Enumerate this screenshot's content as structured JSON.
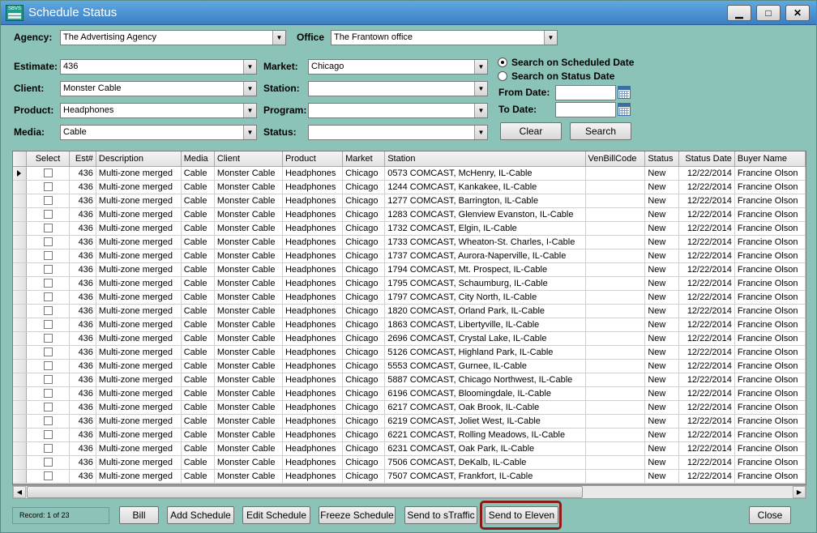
{
  "window": {
    "title": "Schedule Status",
    "icon_text": "SBVS",
    "minimize_glyph": "▁",
    "maximize_glyph": "□",
    "close_glyph": "✕"
  },
  "filters": {
    "agency_label": "Agency:",
    "agency_value": "The Advertising Agency",
    "office_label": "Office",
    "office_value": "The Frantown office",
    "estimate_label": "Estimate:",
    "estimate_value": "436",
    "client_label": "Client:",
    "client_value": "Monster Cable",
    "product_label": "Product:",
    "product_value": "Headphones",
    "media_label": "Media:",
    "media_value": "Cable",
    "market_label": "Market:",
    "market_value": "Chicago",
    "station_label": "Station:",
    "station_value": "",
    "program_label": "Program:",
    "program_value": "",
    "status_label": "Status:",
    "status_value": "",
    "radio_scheduled": "Search on Scheduled Date",
    "radio_status": "Search on Status Date",
    "selected_radio": "scheduled",
    "from_label": "From Date:",
    "to_label": "To Date:",
    "from_value": "",
    "to_value": "",
    "clear_label": "Clear",
    "search_label": "Search"
  },
  "table": {
    "columns": [
      "Select",
      "Est#",
      "Description",
      "Media",
      "Client",
      "Product",
      "Market",
      "Station",
      "VenBillCode",
      "Status",
      "Status Date",
      "Buyer Name"
    ],
    "rows": [
      [
        "",
        "436",
        "Multi-zone merged",
        "Cable",
        "Monster Cable",
        "Headphones",
        "Chicago",
        "0573 COMCAST, McHenry, IL-Cable",
        "",
        "New",
        "12/22/2014",
        "Francine Olson"
      ],
      [
        "",
        "436",
        "Multi-zone merged",
        "Cable",
        "Monster Cable",
        "Headphones",
        "Chicago",
        "1244 COMCAST, Kankakee, IL-Cable",
        "",
        "New",
        "12/22/2014",
        "Francine Olson"
      ],
      [
        "",
        "436",
        "Multi-zone merged",
        "Cable",
        "Monster Cable",
        "Headphones",
        "Chicago",
        "1277 COMCAST, Barrington, IL-Cable",
        "",
        "New",
        "12/22/2014",
        "Francine Olson"
      ],
      [
        "",
        "436",
        "Multi-zone merged",
        "Cable",
        "Monster Cable",
        "Headphones",
        "Chicago",
        "1283 COMCAST, Glenview Evanston, IL-Cable",
        "",
        "New",
        "12/22/2014",
        "Francine Olson"
      ],
      [
        "",
        "436",
        "Multi-zone merged",
        "Cable",
        "Monster Cable",
        "Headphones",
        "Chicago",
        "1732 COMCAST, Elgin, IL-Cable",
        "",
        "New",
        "12/22/2014",
        "Francine Olson"
      ],
      [
        "",
        "436",
        "Multi-zone merged",
        "Cable",
        "Monster Cable",
        "Headphones",
        "Chicago",
        "1733 COMCAST, Wheaton-St. Charles, I-Cable",
        "",
        "New",
        "12/22/2014",
        "Francine Olson"
      ],
      [
        "",
        "436",
        "Multi-zone merged",
        "Cable",
        "Monster Cable",
        "Headphones",
        "Chicago",
        "1737 COMCAST, Aurora-Naperville, IL-Cable",
        "",
        "New",
        "12/22/2014",
        "Francine Olson"
      ],
      [
        "",
        "436",
        "Multi-zone merged",
        "Cable",
        "Monster Cable",
        "Headphones",
        "Chicago",
        "1794 COMCAST, Mt. Prospect, IL-Cable",
        "",
        "New",
        "12/22/2014",
        "Francine Olson"
      ],
      [
        "",
        "436",
        "Multi-zone merged",
        "Cable",
        "Monster Cable",
        "Headphones",
        "Chicago",
        "1795 COMCAST, Schaumburg, IL-Cable",
        "",
        "New",
        "12/22/2014",
        "Francine Olson"
      ],
      [
        "",
        "436",
        "Multi-zone merged",
        "Cable",
        "Monster Cable",
        "Headphones",
        "Chicago",
        "1797 COMCAST, City North, IL-Cable",
        "",
        "New",
        "12/22/2014",
        "Francine Olson"
      ],
      [
        "",
        "436",
        "Multi-zone merged",
        "Cable",
        "Monster Cable",
        "Headphones",
        "Chicago",
        "1820 COMCAST, Orland Park, IL-Cable",
        "",
        "New",
        "12/22/2014",
        "Francine Olson"
      ],
      [
        "",
        "436",
        "Multi-zone merged",
        "Cable",
        "Monster Cable",
        "Headphones",
        "Chicago",
        "1863 COMCAST, Libertyville, IL-Cable",
        "",
        "New",
        "12/22/2014",
        "Francine Olson"
      ],
      [
        "",
        "436",
        "Multi-zone merged",
        "Cable",
        "Monster Cable",
        "Headphones",
        "Chicago",
        "2696 COMCAST, Crystal Lake, IL-Cable",
        "",
        "New",
        "12/22/2014",
        "Francine Olson"
      ],
      [
        "",
        "436",
        "Multi-zone merged",
        "Cable",
        "Monster Cable",
        "Headphones",
        "Chicago",
        "5126 COMCAST, Highland Park, IL-Cable",
        "",
        "New",
        "12/22/2014",
        "Francine Olson"
      ],
      [
        "",
        "436",
        "Multi-zone merged",
        "Cable",
        "Monster Cable",
        "Headphones",
        "Chicago",
        "5553 COMCAST, Gurnee, IL-Cable",
        "",
        "New",
        "12/22/2014",
        "Francine Olson"
      ],
      [
        "",
        "436",
        "Multi-zone merged",
        "Cable",
        "Monster Cable",
        "Headphones",
        "Chicago",
        "5887 COMCAST, Chicago Northwest, IL-Cable",
        "",
        "New",
        "12/22/2014",
        "Francine Olson"
      ],
      [
        "",
        "436",
        "Multi-zone merged",
        "Cable",
        "Monster Cable",
        "Headphones",
        "Chicago",
        "6196 COMCAST, Bloomingdale, IL-Cable",
        "",
        "New",
        "12/22/2014",
        "Francine Olson"
      ],
      [
        "",
        "436",
        "Multi-zone merged",
        "Cable",
        "Monster Cable",
        "Headphones",
        "Chicago",
        "6217 COMCAST, Oak Brook, IL-Cable",
        "",
        "New",
        "12/22/2014",
        "Francine Olson"
      ],
      [
        "",
        "436",
        "Multi-zone merged",
        "Cable",
        "Monster Cable",
        "Headphones",
        "Chicago",
        "6219 COMCAST, Joliet West, IL-Cable",
        "",
        "New",
        "12/22/2014",
        "Francine Olson"
      ],
      [
        "",
        "436",
        "Multi-zone merged",
        "Cable",
        "Monster Cable",
        "Headphones",
        "Chicago",
        "6221 COMCAST, Rolling Meadows, IL-Cable",
        "",
        "New",
        "12/22/2014",
        "Francine Olson"
      ],
      [
        "",
        "436",
        "Multi-zone merged",
        "Cable",
        "Monster Cable",
        "Headphones",
        "Chicago",
        "6231 COMCAST, Oak Park, IL-Cable",
        "",
        "New",
        "12/22/2014",
        "Francine Olson"
      ],
      [
        "",
        "436",
        "Multi-zone merged",
        "Cable",
        "Monster Cable",
        "Headphones",
        "Chicago",
        "7506 COMCAST, DeKalb, IL-Cable",
        "",
        "New",
        "12/22/2014",
        "Francine Olson"
      ],
      [
        "",
        "436",
        "Multi-zone merged",
        "Cable",
        "Monster Cable",
        "Headphones",
        "Chicago",
        "7507 COMCAST, Frankfort, IL-Cable",
        "",
        "New",
        "12/22/2014",
        "Francine Olson"
      ]
    ]
  },
  "footer": {
    "record_text": "Record:    1 of 23",
    "bill_label": "Bill",
    "add_schedule_label": "Add Schedule",
    "edit_schedule_label": "Edit Schedule",
    "freeze_schedule_label": "Freeze Schedule",
    "send_straffic_label": "Send to sTraffic",
    "send_eleven_label": "Send to Eleven",
    "close_label": "Close"
  },
  "colors": {
    "window_bg": "#8cc3b8",
    "titlebar": "#3b7fc4",
    "highlight": "#8b1a1a"
  },
  "icons": {
    "combo_arrow": "chevron-down-icon",
    "calendar": "calendar-icon",
    "row_pointer": "row-pointer-icon"
  }
}
